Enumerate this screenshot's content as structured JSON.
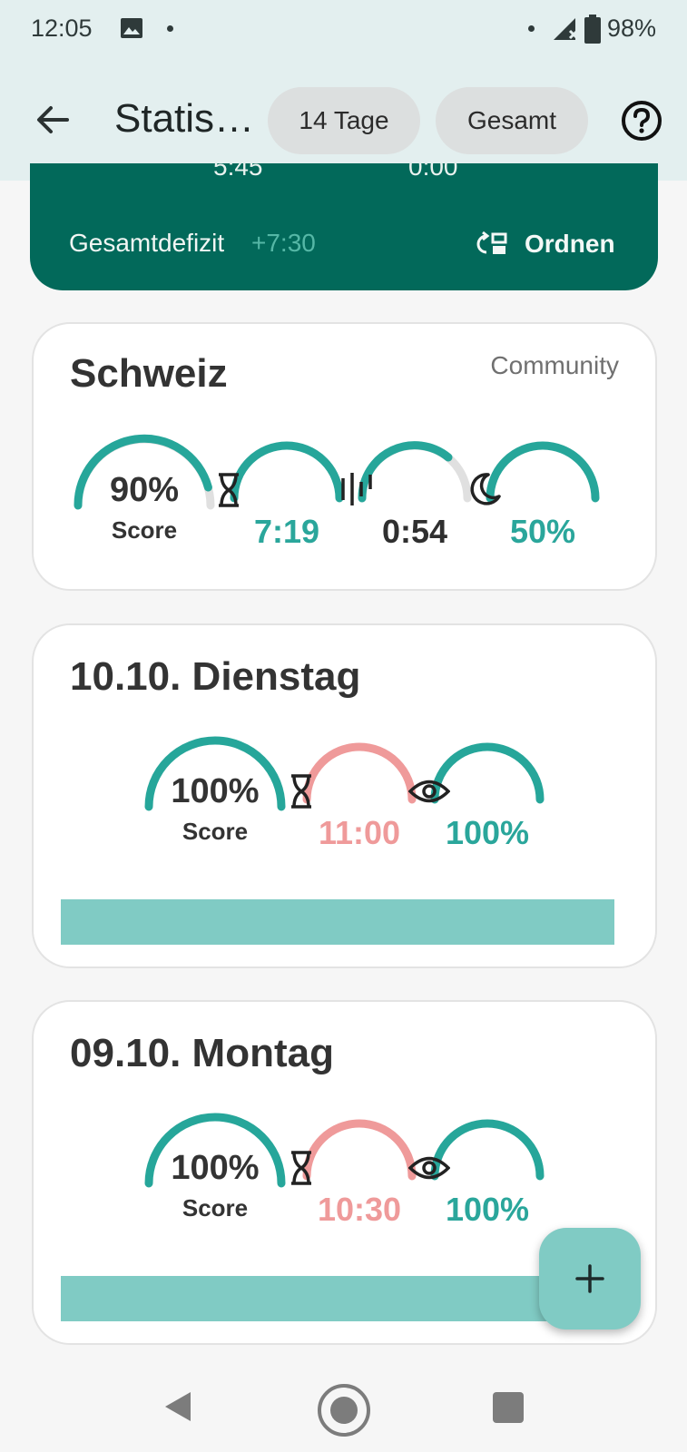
{
  "status_bar": {
    "time": "12:05",
    "battery": "98%"
  },
  "app_bar": {
    "title": "Statis…",
    "chips": [
      "14 Tage",
      "Gesamt"
    ]
  },
  "summary": {
    "cut_values": [
      "5:45",
      "0:00"
    ],
    "deficit_label": "Gesamtdefizit",
    "deficit_value": "+7:30",
    "sort_label": "Ordnen"
  },
  "cards": [
    {
      "title": "Schweiz",
      "tag": "Community",
      "gauges": [
        {
          "value": "90%",
          "label": "Score",
          "icon": "",
          "fill": 0.9
        },
        {
          "value": "7:19",
          "icon": "hourglass-icon",
          "fill": 1.0
        },
        {
          "value": "0:54",
          "icon": "bars-icon",
          "fill": 0.6
        },
        {
          "value": "50%",
          "icon": "moon-icon",
          "fill": 1.0
        }
      ]
    },
    {
      "title": "10.10. Dienstag",
      "gauges": [
        {
          "value": "100%",
          "label": "Score",
          "fill": 1.0
        },
        {
          "value": "11:00",
          "icon": "hourglass-icon",
          "fill": 1.0
        },
        {
          "value": "100%",
          "icon": "eye-icon",
          "fill": 1.0
        }
      ]
    },
    {
      "title": "09.10. Montag",
      "gauges": [
        {
          "value": "100%",
          "label": "Score",
          "fill": 1.0
        },
        {
          "value": "10:30",
          "icon": "hourglass-icon",
          "fill": 1.0
        },
        {
          "value": "100%",
          "icon": "eye-icon",
          "fill": 1.0
        }
      ]
    }
  ],
  "colors": {
    "teal": "#26a69a",
    "pink": "#ef9a9a",
    "dark_green": "#02695a",
    "bar_teal": "#80cbc4",
    "gauge_track": "#e0e0e0"
  }
}
